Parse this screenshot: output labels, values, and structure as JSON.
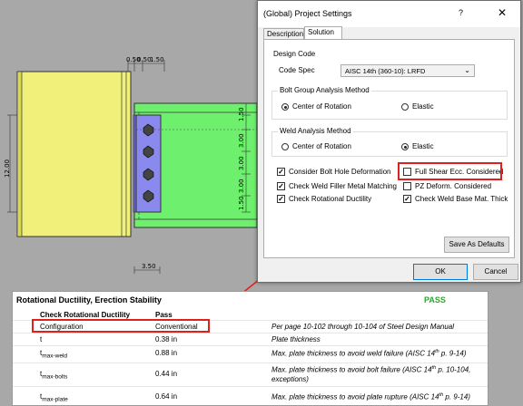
{
  "drawing": {
    "dims": {
      "top_a": "0.50",
      "top_b": "0.50",
      "top_c": "1.50",
      "left_height": "12.00",
      "right_top": "1.50",
      "right_mid1": "3.00",
      "right_mid2": "3.00",
      "right_mid3": "3.00",
      "right_bot": "1.50",
      "bottom": "3.50"
    }
  },
  "dialog": {
    "title": "(Global) Project Settings",
    "help": "?",
    "close": "✕",
    "tabs": [
      {
        "label": "Description"
      },
      {
        "label": "Solution"
      }
    ],
    "design_code": {
      "title": "Design Code",
      "code_spec_label": "Code Spec",
      "code_spec_value": "AISC 14th (360-10): LRFD"
    },
    "bolt_group": {
      "title": "Bolt Group Analysis Method",
      "opt1": "Center of Rotation",
      "opt2": "Elastic"
    },
    "weld": {
      "title": "Weld Analysis Method",
      "opt1": "Center of Rotation",
      "opt2": "Elastic"
    },
    "checks": {
      "c1": "Consider Bolt Hole Deformation",
      "c2": "Full Shear Ecc. Considered",
      "c3": "Check Weld Filler Metal Matching",
      "c4": "PZ Deform. Considered",
      "c5": "Check Rotational Ductility",
      "c6": "Check Weld Base Mat. Thick"
    },
    "save_defaults": "Save As Defaults",
    "ok": "OK",
    "cancel": "Cancel"
  },
  "report": {
    "title": "Rotational Ductility, Erection Stability",
    "status": "PASS",
    "header": {
      "col1": "Check Rotational Ductility",
      "col2": "Pass"
    },
    "rows": [
      {
        "label": "Configuration",
        "value": "Conventional",
        "note": "Per page 10-102 through 10-104 of Steel Design Manual"
      },
      {
        "label": "t",
        "value": "0.38 in",
        "note": "Plate thickness"
      },
      {
        "label": "t",
        "sub": "max-weld",
        "value": "0.88 in",
        "note": "Max. plate thickness to avoid weld failure (AISC 14",
        "sup": "th",
        "note_end": " p. 9-14)"
      },
      {
        "label": "t",
        "sub": "max-bolts",
        "value": "0.44 in",
        "note": "Max. plate thickness to avoid bolt failure (AISC 14",
        "sup": "th",
        "note_end": " p. 10-104,",
        "note2": "exceptions)"
      },
      {
        "label": "t",
        "sub": "max-plate",
        "value": "0.64 in",
        "note": "Max. plate thickness to avoid plate rupture (AISC 14",
        "sup": "th",
        "note_end": " p. 9-14)"
      }
    ]
  }
}
